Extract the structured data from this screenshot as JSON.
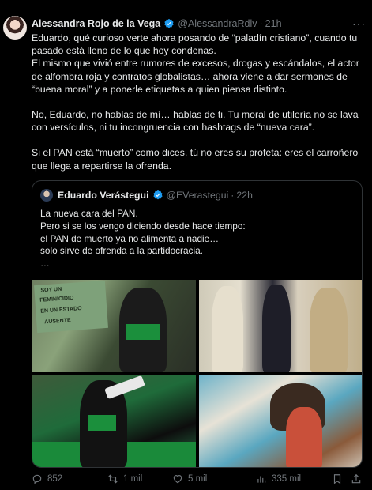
{
  "tweet": {
    "author": {
      "name": "Alessandra Rojo de la Vega",
      "handle": "@AlessandraRdlv",
      "time": "21h"
    },
    "paragraphs": [
      "Eduardo, qué curioso verte ahora posando de “paladín cristiano”, cuando tu pasado está lleno de lo que hoy condenas.\nEl mismo que vivió entre rumores de excesos, drogas y escándalos, el actor de alfombra roja y contratos globalistas… ahora viene a dar sermones de “buena moral” y a ponerle etiquetas a quien piensa distinto.",
      "No, Eduardo, no hablas de mí… hablas de ti. Tu moral de utilería no se lava con versículos, ni tu incongruencia con hashtags de “nueva cara”.",
      "Si el PAN está “muerto” como dices, tú no eres su profeta: eres el carroñero que llega a repartirse la ofrenda."
    ],
    "quoted": {
      "name": "Eduardo Verástegui",
      "handle": "@EVerastegui",
      "time": "22h",
      "text": "La nueva cara del PAN.\nPero si se los vengo diciendo desde hace tiempo:\nel PAN de muerto ya no alimenta a nadie…\nsolo sirve de ofrenda a la partidocracia.\n…",
      "sign_text": [
        "SOY UN",
        "FEMINICIDIO",
        "EN UN ESTADO",
        "AUSENTE"
      ]
    },
    "metrics": {
      "replies": "852",
      "retweets": "1 mil",
      "likes": "5 mil",
      "views": "335 mil"
    },
    "colors": {
      "background": "#000000",
      "text": "#e7e9ea",
      "muted": "#71767b",
      "verified": "#1d9bf0",
      "border": "#2f3336"
    }
  }
}
